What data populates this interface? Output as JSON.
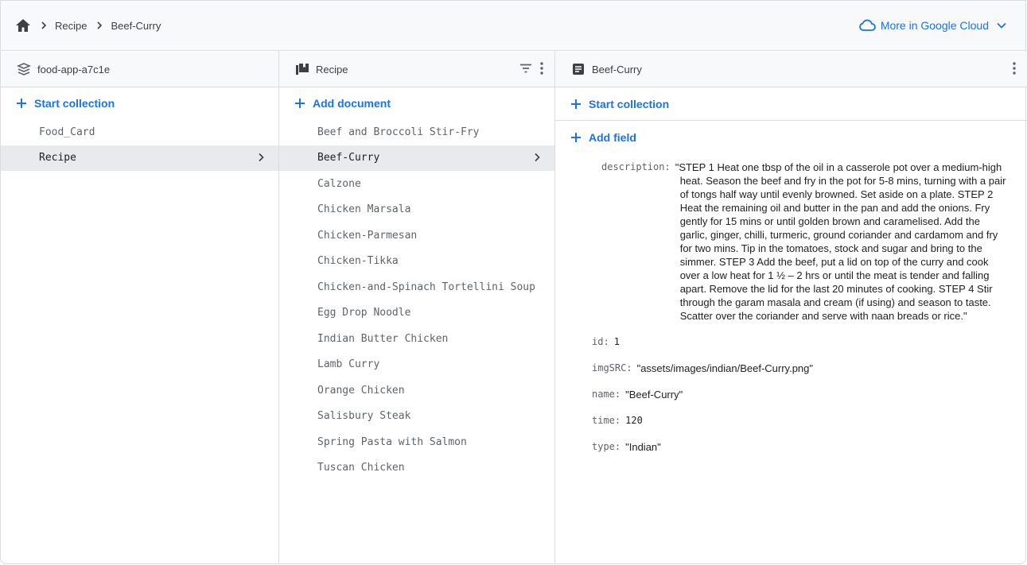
{
  "breadcrumb": {
    "items": [
      "Recipe",
      "Beef-Curry"
    ]
  },
  "header": {
    "more_cloud_label": "More in Google Cloud"
  },
  "colors": {
    "accent": "#1a73e8",
    "border": "#dadce0",
    "selected_bg": "#e8eaed",
    "header_bg": "#f8f9fa"
  },
  "col1": {
    "title": "food-app-a7c1e",
    "icon": "database-icon",
    "action_label": "Start collection",
    "items": [
      {
        "label": "Food_Card"
      },
      {
        "label": "Recipe"
      }
    ]
  },
  "col2": {
    "title": "Recipe",
    "icon": "collection-icon",
    "action_label": "Add document",
    "items": [
      {
        "label": "Beef and Broccoli Stir-Fry"
      },
      {
        "label": "Beef-Curry"
      },
      {
        "label": "Calzone"
      },
      {
        "label": "Chicken Marsala"
      },
      {
        "label": "Chicken-Parmesan"
      },
      {
        "label": "Chicken-Tikka"
      },
      {
        "label": "Chicken-and-Spinach Tortellini Soup"
      },
      {
        "label": "Egg Drop Noodle"
      },
      {
        "label": "Indian Butter Chicken"
      },
      {
        "label": "Lamb Curry"
      },
      {
        "label": "Orange Chicken"
      },
      {
        "label": "Salisbury Steak"
      },
      {
        "label": "Spring Pasta with Salmon"
      },
      {
        "label": "Tuscan Chicken"
      }
    ]
  },
  "col3": {
    "title": "Beef-Curry",
    "icon": "document-icon",
    "start_collection_label": "Start collection",
    "add_field_label": "Add field",
    "fields": [
      {
        "key": "description:",
        "value": "\"STEP 1 Heat one tbsp of the oil in a casserole pot over a medium-high heat. Season the beef and fry in the pot for 5-8 mins, turning with a pair of tongs half way until evenly browned. Set aside on a plate. STEP 2 Heat the remaining oil and butter in the pan and add the onions. Fry gently for 15 mins or until golden brown and caramelised. Add the garlic, ginger, chilli, turmeric, ground coriander and cardamom and fry for two mins. Tip in the tomatoes, stock and sugar and bring to the simmer. STEP 3 Add the beef, put a lid on top of the curry and cook over a low heat for 1 ½ – 2 hrs or until the meat is tender and falling apart. Remove the lid for the last 20 minutes of cooking. STEP 4 Stir through the garam masala and cream (if using) and season to taste. Scatter over the coriander and serve with naan breads or rice.\""
      },
      {
        "key": "id:",
        "value": "1"
      },
      {
        "key": "imgSRC:",
        "value": "\"assets/images/indian/Beef-Curry.png\""
      },
      {
        "key": "name:",
        "value": "\"Beef-Curry\""
      },
      {
        "key": "time:",
        "value": "120"
      },
      {
        "key": "type:",
        "value": "\"Indian\""
      }
    ]
  }
}
